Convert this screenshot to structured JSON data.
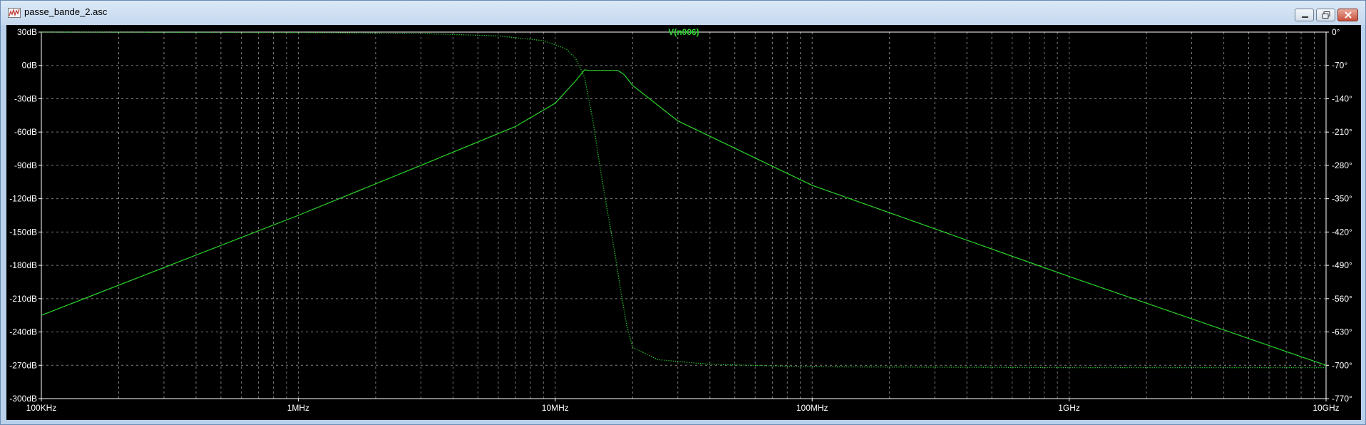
{
  "window": {
    "title": "passe_bande_2.asc",
    "accent_color": "#b9d1ea"
  },
  "icons": {
    "app": "waveform-icon",
    "minimize": "minimize-icon",
    "maximize": "maximize-icon",
    "close": "close-icon"
  },
  "chart_data": {
    "type": "line",
    "title": "V(n006)",
    "background": "#000000",
    "trace_color": "#2bd42b",
    "grid": true,
    "x_scale": "log",
    "xlim": [
      100000,
      10000000000
    ],
    "x_ticks": [
      {
        "value": 100000,
        "label": "100KHz"
      },
      {
        "value": 1000000,
        "label": "1MHz"
      },
      {
        "value": 10000000,
        "label": "10MHz"
      },
      {
        "value": 100000000,
        "label": "100MHz"
      },
      {
        "value": 1000000000,
        "label": "1GHz"
      },
      {
        "value": 10000000000,
        "label": "10GHz"
      }
    ],
    "ylim": [
      -300,
      30
    ],
    "y_ticks": [
      {
        "value": 30,
        "label": "30dB"
      },
      {
        "value": 0,
        "label": "0dB"
      },
      {
        "value": -30,
        "label": "-30dB"
      },
      {
        "value": -60,
        "label": "-60dB"
      },
      {
        "value": -90,
        "label": "-90dB"
      },
      {
        "value": -120,
        "label": "-120dB"
      },
      {
        "value": -150,
        "label": "-150dB"
      },
      {
        "value": -180,
        "label": "-180dB"
      },
      {
        "value": -210,
        "label": "-210dB"
      },
      {
        "value": -240,
        "label": "-240dB"
      },
      {
        "value": -270,
        "label": "-270dB"
      },
      {
        "value": -300,
        "label": "-300dB"
      }
    ],
    "y2lim": [
      -770,
      0
    ],
    "y2_ticks": [
      {
        "value": 0,
        "label": "0°"
      },
      {
        "value": -70,
        "label": "-70°"
      },
      {
        "value": -140,
        "label": "-140°"
      },
      {
        "value": -210,
        "label": "-210°"
      },
      {
        "value": -280,
        "label": "-280°"
      },
      {
        "value": -350,
        "label": "-350°"
      },
      {
        "value": -420,
        "label": "-420°"
      },
      {
        "value": -490,
        "label": "-490°"
      },
      {
        "value": -560,
        "label": "-560°"
      },
      {
        "value": -630,
        "label": "-630°"
      },
      {
        "value": -700,
        "label": "-700°"
      },
      {
        "value": -770,
        "label": "-770°"
      }
    ],
    "series": [
      {
        "axis": "magnitude",
        "style": "solid",
        "x": [
          100000,
          300000,
          1000000,
          3000000,
          7000000,
          10000000,
          12000000,
          13000000,
          13500000,
          16000000,
          17500000,
          18500000,
          20000000,
          30000000,
          100000000,
          1000000000,
          10000000000
        ],
        "y": [
          -225,
          -182,
          -135,
          -90,
          -55,
          -34,
          -14,
          -4,
          -4.5,
          -4.5,
          -4.5,
          -8,
          -18,
          -50,
          -108,
          -190,
          -270
        ]
      },
      {
        "axis": "phase",
        "style": "dotted",
        "x": [
          100000,
          1000000,
          3000000,
          6000000,
          9000000,
          11000000,
          12000000,
          13000000,
          14000000,
          15000000,
          16000000,
          17000000,
          18000000,
          19000000,
          20000000,
          25000000,
          40000000,
          100000000,
          1000000000,
          10000000000
        ],
        "y": [
          0,
          -1,
          -3,
          -8,
          -18,
          -35,
          -55,
          -95,
          -185,
          -290,
          -380,
          -460,
          -545,
          -618,
          -662,
          -688,
          -698,
          -703,
          -705,
          -705
        ]
      }
    ]
  }
}
